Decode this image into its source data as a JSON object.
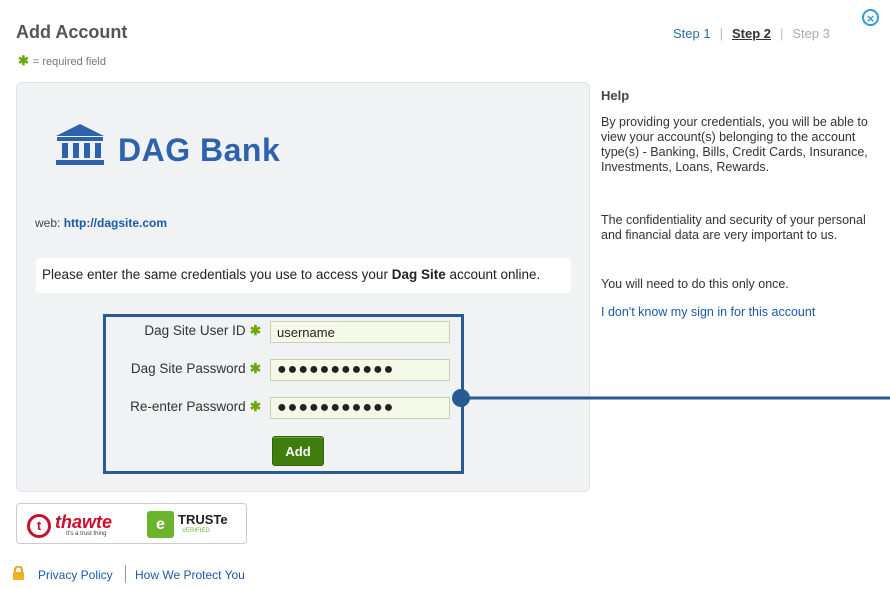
{
  "header": {
    "title": "Add Account",
    "required_note": "= required field",
    "steps": [
      "Step 1",
      "Step 2",
      "Step 3"
    ],
    "close_glyph": "×"
  },
  "bank": {
    "name": "DAG Bank",
    "web_label": "web:",
    "web_url": "http://dagsite.com",
    "message_before": "Please enter the same credentials you use to access your ",
    "message_bold": "Dag Site",
    "message_after": " account online."
  },
  "form": {
    "userid_label": "Dag Site User ID",
    "userid_value": "username",
    "password_label": "Dag Site Password",
    "password_value": "●●●●●●●●●●●",
    "reenter_label": "Re-enter Password",
    "reenter_value": "●●●●●●●●●●●",
    "add_label": "Add"
  },
  "badges": {
    "thawte_name": "thawte",
    "thawte_tagline": "It's a trust thing",
    "truste_name": "TRUSTe",
    "truste_verified": "VERIFIED"
  },
  "footer": {
    "privacy_label": "Privacy Policy",
    "protect_label": "How We Protect You"
  },
  "help": {
    "title": "Help",
    "para1": "By providing your credentials, you will be able to view your account(s) belonging to the account type(s) - Banking, Bills, Credit Cards, Insurance, Investments, Loans, Rewards.",
    "para2": "The confidentiality and security of your personal and financial data are very important to us.",
    "para3": "You will need to do this only once.",
    "link": "I don't know my sign in for this account"
  },
  "colors": {
    "accent_blue": "#2e62ad",
    "link_blue": "#1c5aa6",
    "required_green": "#6ea70a",
    "add_button_green": "#3f7d0f",
    "highlight_frame": "#285a94"
  },
  "icons": [
    "close-icon",
    "bank-building-icon",
    "required-star-icon",
    "lock-icon",
    "thawte-logo",
    "truste-logo"
  ]
}
